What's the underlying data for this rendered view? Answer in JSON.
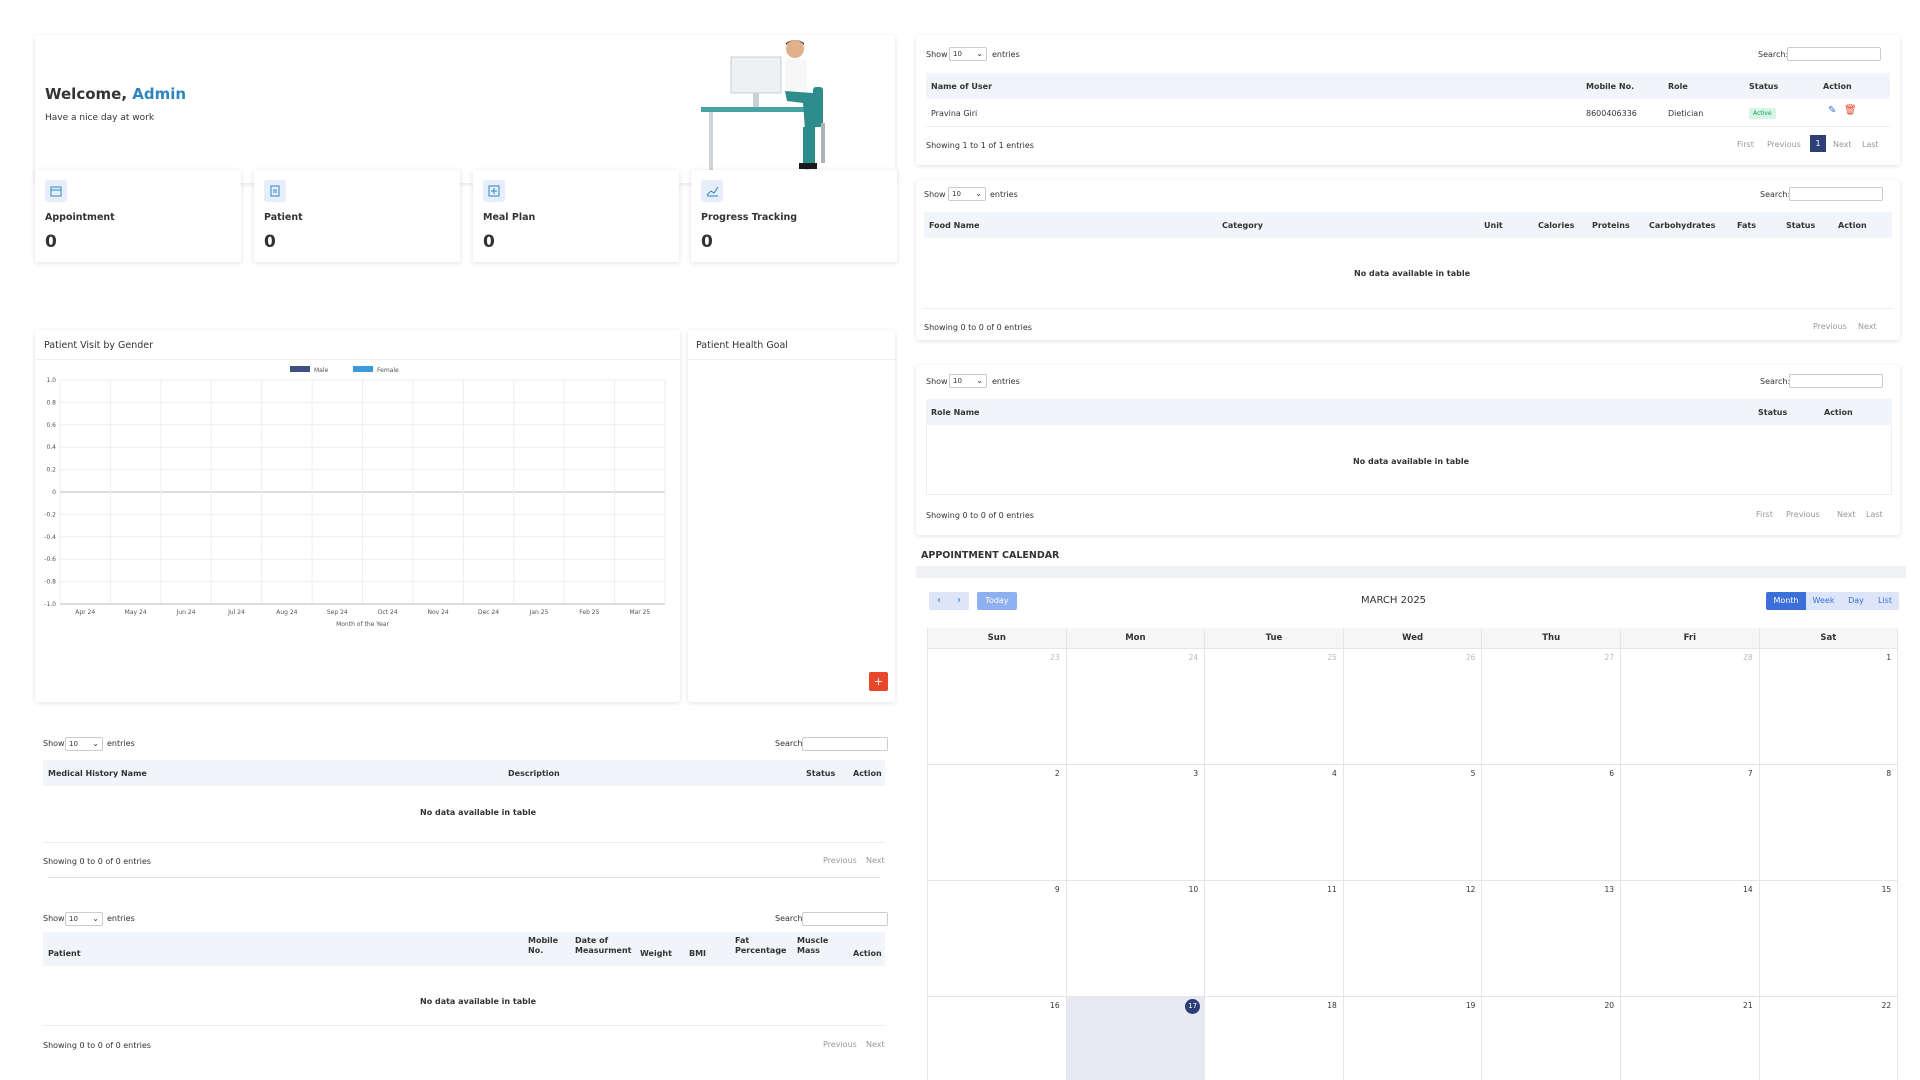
{
  "welcome": {
    "greeting": "Welcome,",
    "name": "Admin",
    "subtitle": "Have a nice day at work"
  },
  "stats": [
    {
      "label": "Appointment",
      "value": "0",
      "icon": "calendar-icon"
    },
    {
      "label": "Patient",
      "value": "0",
      "icon": "document-icon"
    },
    {
      "label": "Meal Plan",
      "value": "0",
      "icon": "plus-square-icon"
    },
    {
      "label": "Progress Tracking",
      "value": "0",
      "icon": "chart-line-icon"
    }
  ],
  "chart_panel": {
    "title": "Patient Visit by Gender"
  },
  "health_goal": {
    "title": "Patient Health Goal",
    "add_label": "+"
  },
  "chart_data": {
    "type": "bar",
    "categories": [
      "Apr 24",
      "May 24",
      "Jun 24",
      "Jul 24",
      "Aug 24",
      "Sep 24",
      "Oct 24",
      "Nov 24",
      "Dec 24",
      "Jan 25",
      "Feb 25",
      "Mar 25"
    ],
    "series": [
      {
        "name": "Male",
        "values": [
          0,
          0,
          0,
          0,
          0,
          0,
          0,
          0,
          0,
          0,
          0,
          0
        ],
        "color": "#3d4f85"
      },
      {
        "name": "Female",
        "values": [
          0,
          0,
          0,
          0,
          0,
          0,
          0,
          0,
          0,
          0,
          0,
          0
        ],
        "color": "#3b9ad9"
      }
    ],
    "xlabel": "Month of the Year",
    "ylabel": "",
    "ylim": [
      -1.0,
      1.0
    ],
    "yticks": [
      "1.0",
      "0.8",
      "0.6",
      "0.4",
      "0.2",
      "0",
      "-0.2",
      "-0.4",
      "-0.6",
      "-0.8",
      "-1.0"
    ],
    "grid": true,
    "legend": "top-center"
  },
  "common": {
    "show": "Show",
    "entries": "entries",
    "search": "Search:",
    "page_size": "10",
    "first": "First",
    "previous": "Previous",
    "next": "Next",
    "last": "Last",
    "no_data": "No data available in table",
    "empty_info": "Showing 0 to 0 of 0 entries"
  },
  "users_table": {
    "columns": [
      "Name of User",
      "Mobile No.",
      "Role",
      "Status",
      "Action"
    ],
    "row": {
      "name": "Pravina Giri",
      "mobile": "8600406336",
      "role": "Dietician",
      "status": "Active"
    },
    "info": "Showing 1 to 1 of 1 entries",
    "current_page": "1"
  },
  "food_table": {
    "columns": [
      "Food Name",
      "Category",
      "Unit",
      "Calories",
      "Proteins",
      "Carbohydrates",
      "Fats",
      "Status",
      "Action"
    ]
  },
  "role_table": {
    "columns": [
      "Role Name",
      "Status",
      "Action"
    ]
  },
  "medical_table": {
    "columns": [
      "Medical History Name",
      "Description",
      "Status",
      "Action"
    ]
  },
  "measure_table": {
    "columns": [
      "Patient",
      "Mobile No.",
      "Date of Measurment",
      "Weight",
      "BMI",
      "Fat Percentage",
      "Muscle Mass",
      "Action"
    ]
  },
  "calendar": {
    "section_title": "APPOINTMENT CALENDAR",
    "title": "MARCH 2025",
    "today_label": "Today",
    "views": [
      "Month",
      "Week",
      "Day",
      "List"
    ],
    "active_view": "Month",
    "days": [
      "Sun",
      "Mon",
      "Tue",
      "Wed",
      "Thu",
      "Fri",
      "Sat"
    ],
    "weeks": [
      [
        "23",
        "24",
        "25",
        "26",
        "27",
        "28",
        "1"
      ],
      [
        "2",
        "3",
        "4",
        "5",
        "6",
        "7",
        "8"
      ],
      [
        "9",
        "10",
        "11",
        "12",
        "13",
        "14",
        "15"
      ],
      [
        "16",
        "17",
        "18",
        "19",
        "20",
        "21",
        "22"
      ]
    ],
    "today": "17"
  }
}
